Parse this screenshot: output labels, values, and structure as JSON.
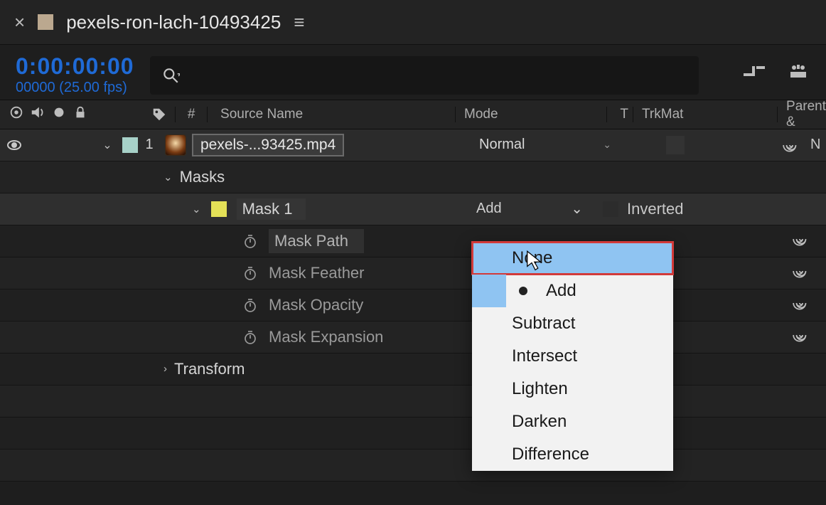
{
  "titlebar": {
    "close_glyph": "×",
    "comp_name": "pexels-ron-lach-10493425",
    "menu_glyph": "≡"
  },
  "time": {
    "timecode": "0:00:00:00",
    "fps_line": "00000 (25.00 fps)"
  },
  "headers": {
    "hash": "#",
    "source": "Source Name",
    "mode": "Mode",
    "t": "T",
    "trkmat": "TrkMat",
    "parent": "Parent &"
  },
  "layer": {
    "index": "1",
    "name": "pexels-...93425.mp4",
    "mode": "Normal",
    "parent_value": "N"
  },
  "groups": {
    "masks": "Masks",
    "mask1": "Mask 1",
    "mask_mode_current": "Add",
    "inverted_label": "Inverted",
    "mask_path": "Mask Path",
    "mask_feather": "Mask Feather",
    "mask_opacity": "Mask Opacity",
    "mask_expansion": "Mask Expansion",
    "transform": "Transform"
  },
  "mode_menu": {
    "items": [
      "None",
      "Add",
      "Subtract",
      "Intersect",
      "Lighten",
      "Darken",
      "Difference"
    ],
    "highlighted": "None",
    "current": "Add"
  }
}
